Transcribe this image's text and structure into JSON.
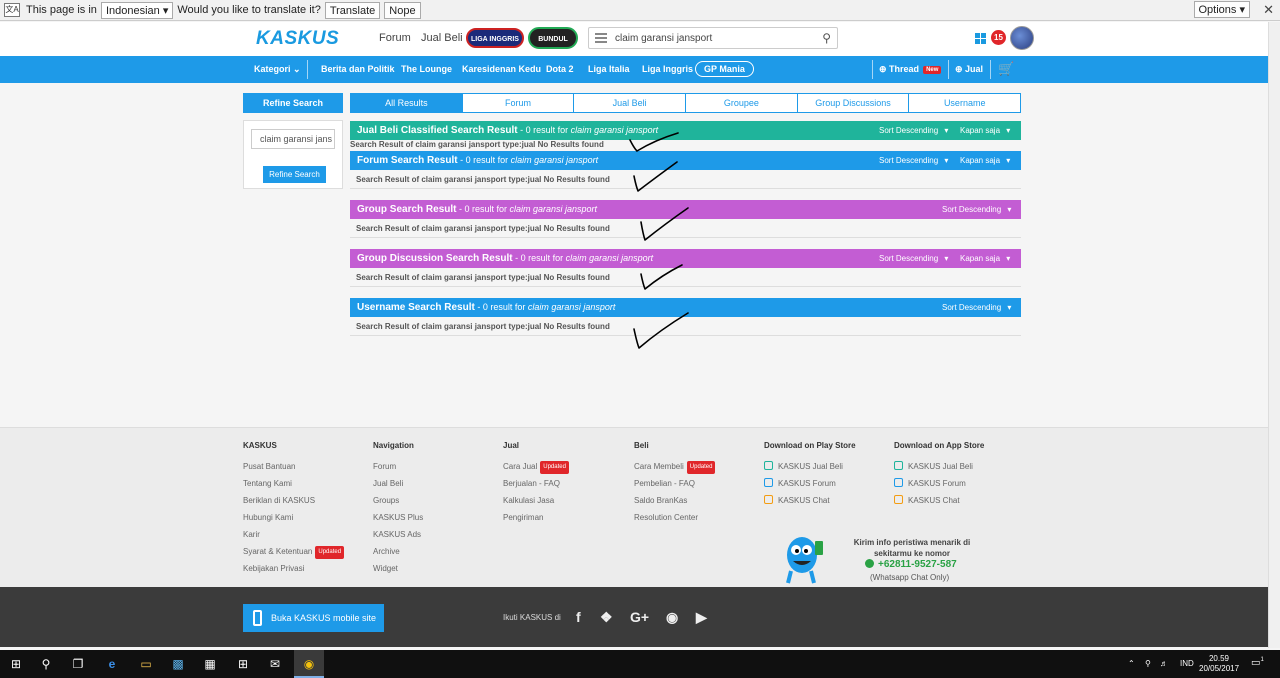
{
  "translate_bar": {
    "prefix": "This page is in",
    "language": "Indonesian",
    "question": "Would you like to translate it?",
    "translate_label": "Translate",
    "nope_label": "Nope",
    "options_label": "Options"
  },
  "header": {
    "logo": "KASKUS",
    "nav": [
      "Forum",
      "Jual Beli"
    ],
    "badge_liga": "LIGA INGGRIS",
    "badge_italia": "BUNDUL ITALIA",
    "search_value": "claim garansi jansport",
    "notification_count": "15"
  },
  "blue_nav": {
    "kategori": "Kategori",
    "items": [
      "Berita dan Politik",
      "The Lounge",
      "Karesidenan Kedu",
      "Dota 2",
      "Liga Italia",
      "Liga Inggris"
    ],
    "gp_mania": "GP Mania",
    "thread": "Thread",
    "new_badge": "New",
    "jual": "Jual"
  },
  "refine": {
    "title": "Refine Search",
    "input_value": "claim garansi jans",
    "button": "Refine Search"
  },
  "tabs": [
    "All Results",
    "Forum",
    "Jual Beli",
    "Groupee",
    "Group Discussions",
    "Username"
  ],
  "sections": [
    {
      "title": "Jual Beli Classified Search Result",
      "count_text": " - 0 result for ",
      "query": "claim garansi jansport",
      "sort": "Sort Descending",
      "time": "Kapan saja",
      "body": "Search Result of claim garansi jansport type:jual No Results found",
      "color": "#1fb49b"
    },
    {
      "title": "Forum Search Result",
      "count_text": " - 0 result for ",
      "query": "claim garansi jansport",
      "sort": "Sort Descending",
      "time": "Kapan saja",
      "body": "Search Result of claim garansi jansport type:jual No Results found",
      "color": "#1e9ae8"
    },
    {
      "title": "Group Search Result",
      "count_text": " - 0 result for ",
      "query": "claim garansi jansport",
      "sort": "Sort Descending",
      "body": "Search Result of claim garansi jansport type:jual No Results found",
      "color": "#c35dd3"
    },
    {
      "title": "Group Discussion Search Result",
      "count_text": " - 0 result for ",
      "query": "claim garansi jansport",
      "sort": "Sort Descending",
      "time": "Kapan saja",
      "body": "Search Result of claim garansi jansport type:jual No Results found",
      "color": "#c35dd3"
    },
    {
      "title": "Username Search Result",
      "count_text": " - 0 result for ",
      "query": "claim garansi jansport",
      "sort": "Sort Descending",
      "body": "Search Result of claim garansi jansport type:jual No Results found",
      "color": "#1e9ae8"
    }
  ],
  "footer": {
    "kaskus": {
      "title": "KASKUS",
      "items": [
        "Pusat Bantuan",
        "Tentang Kami",
        "Beriklan di KASKUS",
        "Hubungi Kami",
        "Karir",
        "Syarat & Ketentuan",
        "Kebijakan Privasi"
      ]
    },
    "navigation": {
      "title": "Navigation",
      "items": [
        "Forum",
        "Jual Beli",
        "Groups",
        "KASKUS Plus",
        "KASKUS Ads",
        "Archive",
        "Widget"
      ]
    },
    "jual": {
      "title": "Jual",
      "items": [
        "Cara Jual",
        "Berjualan - FAQ",
        "Kalkulasi Jasa",
        "Pengiriman"
      ]
    },
    "beli": {
      "title": "Beli",
      "items": [
        "Cara Membeli",
        "Pembelian - FAQ",
        "Saldo BranKas",
        "Resolution Center"
      ]
    },
    "updated_label": "Updated",
    "play_store": {
      "title": "Download on Play Store",
      "items": [
        "KASKUS Jual Beli",
        "KASKUS Forum",
        "KASKUS Chat"
      ]
    },
    "app_store": {
      "title": "Download on App Store",
      "items": [
        "KASKUS Jual Beli",
        "KASKUS Forum",
        "KASKUS Chat"
      ]
    },
    "whatsapp_text_1": "Kirim info peristiwa menarik di",
    "whatsapp_text_2": "sekitarmu ke nomor",
    "whatsapp_phone": "+62811-9527-587",
    "whatsapp_note": "(Whatsapp Chat Only)",
    "mobile_site": "Buka KASKUS mobile site",
    "follow": "Ikuti KASKUS di"
  },
  "taskbar": {
    "language": "IND",
    "time": "20.59",
    "date": "20/05/2017",
    "notification_count": "1"
  },
  "colors": {
    "kaskus_blue": "#1e9ae8",
    "green": "#1fb49b",
    "purple": "#c35dd3",
    "red": "#e0262a"
  }
}
